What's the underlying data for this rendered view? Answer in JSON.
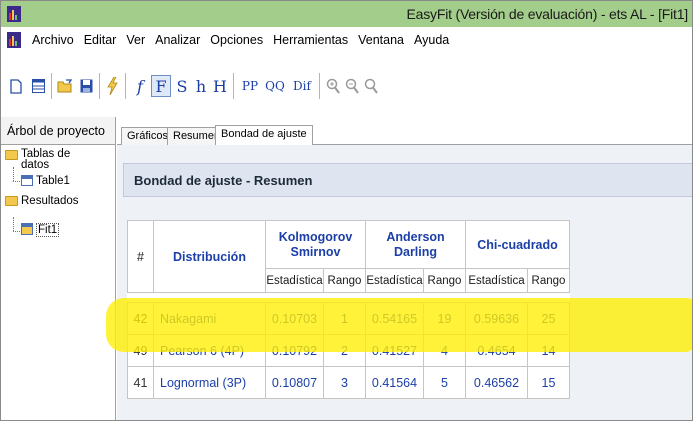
{
  "window": {
    "title": "EasyFit (Versión de evaluación) - ets AL - [Fit1]"
  },
  "menu": [
    "Archivo",
    "Editar",
    "Ver",
    "Analizar",
    "Opciones",
    "Herramientas",
    "Ventana",
    "Ayuda"
  ],
  "toolbar": {
    "buttons": [
      {
        "name": "new-document-icon",
        "label": ""
      },
      {
        "name": "table-icon",
        "label": ""
      },
      {
        "name": "open-folder-icon",
        "label": ""
      },
      {
        "name": "save-icon",
        "label": ""
      },
      {
        "name": "fit-lightning-icon",
        "label": ""
      },
      {
        "name": "pdf-button",
        "label": "f"
      },
      {
        "name": "cdf-button",
        "label": "F"
      },
      {
        "name": "survival-button",
        "label": "S"
      },
      {
        "name": "hazard-button",
        "label": "h"
      },
      {
        "name": "cumulative-hazard-button",
        "label": "H"
      },
      {
        "name": "pp-plot-button",
        "label": "PP"
      },
      {
        "name": "qq-plot-button",
        "label": "QQ"
      },
      {
        "name": "difference-button",
        "label": "Dif"
      },
      {
        "name": "zoom-in-icon",
        "label": ""
      },
      {
        "name": "zoom-out-icon",
        "label": ""
      },
      {
        "name": "zoom-reset-icon",
        "label": ""
      }
    ]
  },
  "left_panel": {
    "title": "Árbol de proyecto",
    "tree": {
      "data_tables": "Tablas de datos",
      "table1": "Table1",
      "results": "Resultados",
      "fit1": "Fit1"
    }
  },
  "tabs": [
    "Gráficos",
    "Resumen",
    "Bondad de ajuste"
  ],
  "active_tab": "Bondad de ajuste",
  "summary": {
    "title": "Bondad de ajuste - Resumen",
    "headers": {
      "num": "#",
      "distribution": "Distribución",
      "ks": "Kolmogorov Smirnov",
      "ks_line1": "Kolmogorov",
      "ks_line2": "Smirnov",
      "ad_line1": "Anderson",
      "ad_line2": "Darling",
      "chi": "Chi-cuadrado",
      "stat": "Estadística",
      "rank": "Rango"
    },
    "rows": [
      {
        "num": "42",
        "dist": "Nakagami",
        "ks_stat": "0.10703",
        "ks_rank": "1",
        "ad_stat": "0.54165",
        "ad_rank": "19",
        "chi_stat": "0.59636",
        "chi_rank": "25"
      },
      {
        "num": "49",
        "dist": "Pearson 6 (4P)",
        "ks_stat": "0.10792",
        "ks_rank": "2",
        "ad_stat": "0.41527",
        "ad_rank": "4",
        "chi_stat": "0.4654",
        "chi_rank": "14"
      },
      {
        "num": "41",
        "dist": "Lognormal (3P)",
        "ks_stat": "0.10807",
        "ks_rank": "3",
        "ad_stat": "0.41564",
        "ad_rank": "5",
        "chi_stat": "0.46562",
        "chi_rank": "15"
      }
    ],
    "highlighted_row": 0,
    "highlight_color": "#ffee00"
  }
}
